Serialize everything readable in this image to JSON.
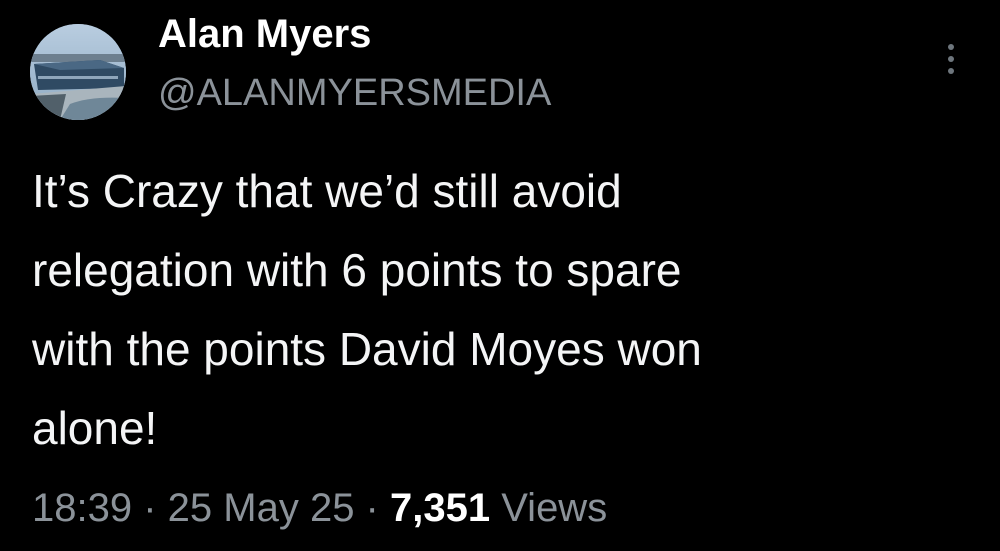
{
  "author": {
    "display_name": "Alan Myers",
    "handle": "@ALANMYERSMEDIA",
    "avatar_icon": "stadium-photo-avatar"
  },
  "more_icon": "more-vertical-icon",
  "tweet": {
    "text": "It’s Crazy that we’d still avoid\nrelegation with 6 points to spare\nwith the points David Moyes won\nalone!"
  },
  "meta": {
    "time": "18:39",
    "separator": " · ",
    "date": "25 May 25",
    "views_count": "7,351",
    "views_label": "Views"
  },
  "colors": {
    "background": "#000000",
    "primary_text": "#ffffff",
    "secondary_text": "#8b9299"
  }
}
